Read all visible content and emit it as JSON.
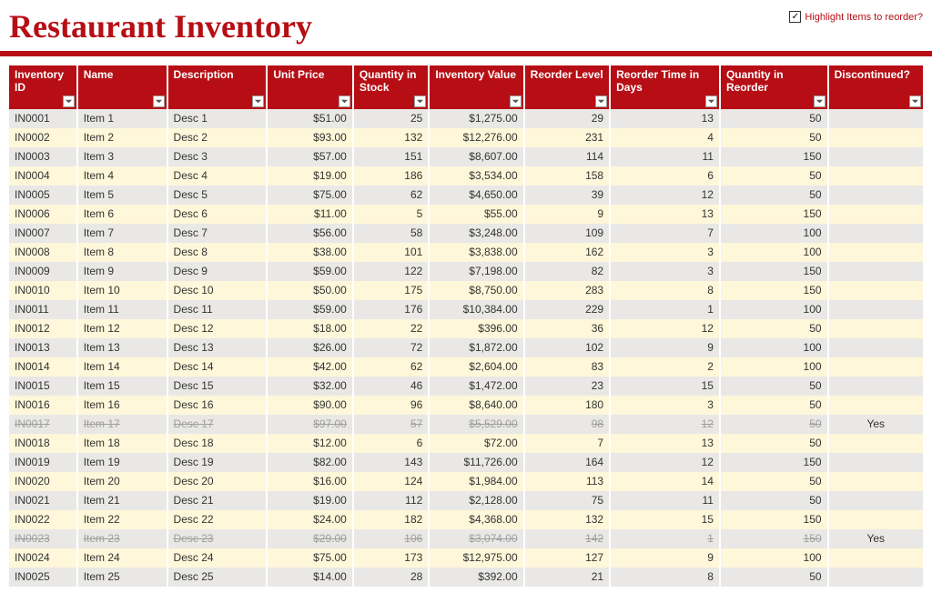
{
  "title": "Restaurant Inventory",
  "highlight_checkbox": {
    "checked": true,
    "label": "Highlight Items to reorder?"
  },
  "columns": [
    {
      "key": "id",
      "label": "Inventory ID"
    },
    {
      "key": "name",
      "label": "Name"
    },
    {
      "key": "desc",
      "label": "Description"
    },
    {
      "key": "price",
      "label": "Unit Price"
    },
    {
      "key": "qty",
      "label": "Quantity in Stock"
    },
    {
      "key": "value",
      "label": "Inventory Value"
    },
    {
      "key": "reorder",
      "label": "Reorder Level"
    },
    {
      "key": "rtime",
      "label": "Reorder Time in Days"
    },
    {
      "key": "rqty",
      "label": "Quantity in Reorder"
    },
    {
      "key": "disc",
      "label": "Discontinued?"
    }
  ],
  "rows": [
    {
      "id": "IN0001",
      "name": "Item 1",
      "desc": "Desc 1",
      "price": "$51.00",
      "qty": "25",
      "value": "$1,275.00",
      "reorder": "29",
      "rtime": "13",
      "rqty": "50",
      "disc": ""
    },
    {
      "id": "IN0002",
      "name": "Item 2",
      "desc": "Desc 2",
      "price": "$93.00",
      "qty": "132",
      "value": "$12,276.00",
      "reorder": "231",
      "rtime": "4",
      "rqty": "50",
      "disc": ""
    },
    {
      "id": "IN0003",
      "name": "Item 3",
      "desc": "Desc 3",
      "price": "$57.00",
      "qty": "151",
      "value": "$8,607.00",
      "reorder": "114",
      "rtime": "11",
      "rqty": "150",
      "disc": ""
    },
    {
      "id": "IN0004",
      "name": "Item 4",
      "desc": "Desc 4",
      "price": "$19.00",
      "qty": "186",
      "value": "$3,534.00",
      "reorder": "158",
      "rtime": "6",
      "rqty": "50",
      "disc": ""
    },
    {
      "id": "IN0005",
      "name": "Item 5",
      "desc": "Desc 5",
      "price": "$75.00",
      "qty": "62",
      "value": "$4,650.00",
      "reorder": "39",
      "rtime": "12",
      "rqty": "50",
      "disc": ""
    },
    {
      "id": "IN0006",
      "name": "Item 6",
      "desc": "Desc 6",
      "price": "$11.00",
      "qty": "5",
      "value": "$55.00",
      "reorder": "9",
      "rtime": "13",
      "rqty": "150",
      "disc": ""
    },
    {
      "id": "IN0007",
      "name": "Item 7",
      "desc": "Desc 7",
      "price": "$56.00",
      "qty": "58",
      "value": "$3,248.00",
      "reorder": "109",
      "rtime": "7",
      "rqty": "100",
      "disc": ""
    },
    {
      "id": "IN0008",
      "name": "Item 8",
      "desc": "Desc 8",
      "price": "$38.00",
      "qty": "101",
      "value": "$3,838.00",
      "reorder": "162",
      "rtime": "3",
      "rqty": "100",
      "disc": ""
    },
    {
      "id": "IN0009",
      "name": "Item 9",
      "desc": "Desc 9",
      "price": "$59.00",
      "qty": "122",
      "value": "$7,198.00",
      "reorder": "82",
      "rtime": "3",
      "rqty": "150",
      "disc": ""
    },
    {
      "id": "IN0010",
      "name": "Item 10",
      "desc": "Desc 10",
      "price": "$50.00",
      "qty": "175",
      "value": "$8,750.00",
      "reorder": "283",
      "rtime": "8",
      "rqty": "150",
      "disc": ""
    },
    {
      "id": "IN0011",
      "name": "Item 11",
      "desc": "Desc 11",
      "price": "$59.00",
      "qty": "176",
      "value": "$10,384.00",
      "reorder": "229",
      "rtime": "1",
      "rqty": "100",
      "disc": ""
    },
    {
      "id": "IN0012",
      "name": "Item 12",
      "desc": "Desc 12",
      "price": "$18.00",
      "qty": "22",
      "value": "$396.00",
      "reorder": "36",
      "rtime": "12",
      "rqty": "50",
      "disc": ""
    },
    {
      "id": "IN0013",
      "name": "Item 13",
      "desc": "Desc 13",
      "price": "$26.00",
      "qty": "72",
      "value": "$1,872.00",
      "reorder": "102",
      "rtime": "9",
      "rqty": "100",
      "disc": ""
    },
    {
      "id": "IN0014",
      "name": "Item 14",
      "desc": "Desc 14",
      "price": "$42.00",
      "qty": "62",
      "value": "$2,604.00",
      "reorder": "83",
      "rtime": "2",
      "rqty": "100",
      "disc": ""
    },
    {
      "id": "IN0015",
      "name": "Item 15",
      "desc": "Desc 15",
      "price": "$32.00",
      "qty": "46",
      "value": "$1,472.00",
      "reorder": "23",
      "rtime": "15",
      "rqty": "50",
      "disc": ""
    },
    {
      "id": "IN0016",
      "name": "Item 16",
      "desc": "Desc 16",
      "price": "$90.00",
      "qty": "96",
      "value": "$8,640.00",
      "reorder": "180",
      "rtime": "3",
      "rqty": "50",
      "disc": ""
    },
    {
      "id": "IN0017",
      "name": "Item 17",
      "desc": "Desc 17",
      "price": "$97.00",
      "qty": "57",
      "value": "$5,529.00",
      "reorder": "98",
      "rtime": "12",
      "rqty": "50",
      "disc": "Yes",
      "discontinued": true
    },
    {
      "id": "IN0018",
      "name": "Item 18",
      "desc": "Desc 18",
      "price": "$12.00",
      "qty": "6",
      "value": "$72.00",
      "reorder": "7",
      "rtime": "13",
      "rqty": "50",
      "disc": ""
    },
    {
      "id": "IN0019",
      "name": "Item 19",
      "desc": "Desc 19",
      "price": "$82.00",
      "qty": "143",
      "value": "$11,726.00",
      "reorder": "164",
      "rtime": "12",
      "rqty": "150",
      "disc": ""
    },
    {
      "id": "IN0020",
      "name": "Item 20",
      "desc": "Desc 20",
      "price": "$16.00",
      "qty": "124",
      "value": "$1,984.00",
      "reorder": "113",
      "rtime": "14",
      "rqty": "50",
      "disc": ""
    },
    {
      "id": "IN0021",
      "name": "Item 21",
      "desc": "Desc 21",
      "price": "$19.00",
      "qty": "112",
      "value": "$2,128.00",
      "reorder": "75",
      "rtime": "11",
      "rqty": "50",
      "disc": ""
    },
    {
      "id": "IN0022",
      "name": "Item 22",
      "desc": "Desc 22",
      "price": "$24.00",
      "qty": "182",
      "value": "$4,368.00",
      "reorder": "132",
      "rtime": "15",
      "rqty": "150",
      "disc": ""
    },
    {
      "id": "IN0023",
      "name": "Item 23",
      "desc": "Desc 23",
      "price": "$29.00",
      "qty": "106",
      "value": "$3,074.00",
      "reorder": "142",
      "rtime": "1",
      "rqty": "150",
      "disc": "Yes",
      "discontinued": true
    },
    {
      "id": "IN0024",
      "name": "Item 24",
      "desc": "Desc 24",
      "price": "$75.00",
      "qty": "173",
      "value": "$12,975.00",
      "reorder": "127",
      "rtime": "9",
      "rqty": "100",
      "disc": ""
    },
    {
      "id": "IN0025",
      "name": "Item 25",
      "desc": "Desc 25",
      "price": "$14.00",
      "qty": "28",
      "value": "$392.00",
      "reorder": "21",
      "rtime": "8",
      "rqty": "50",
      "disc": ""
    }
  ]
}
